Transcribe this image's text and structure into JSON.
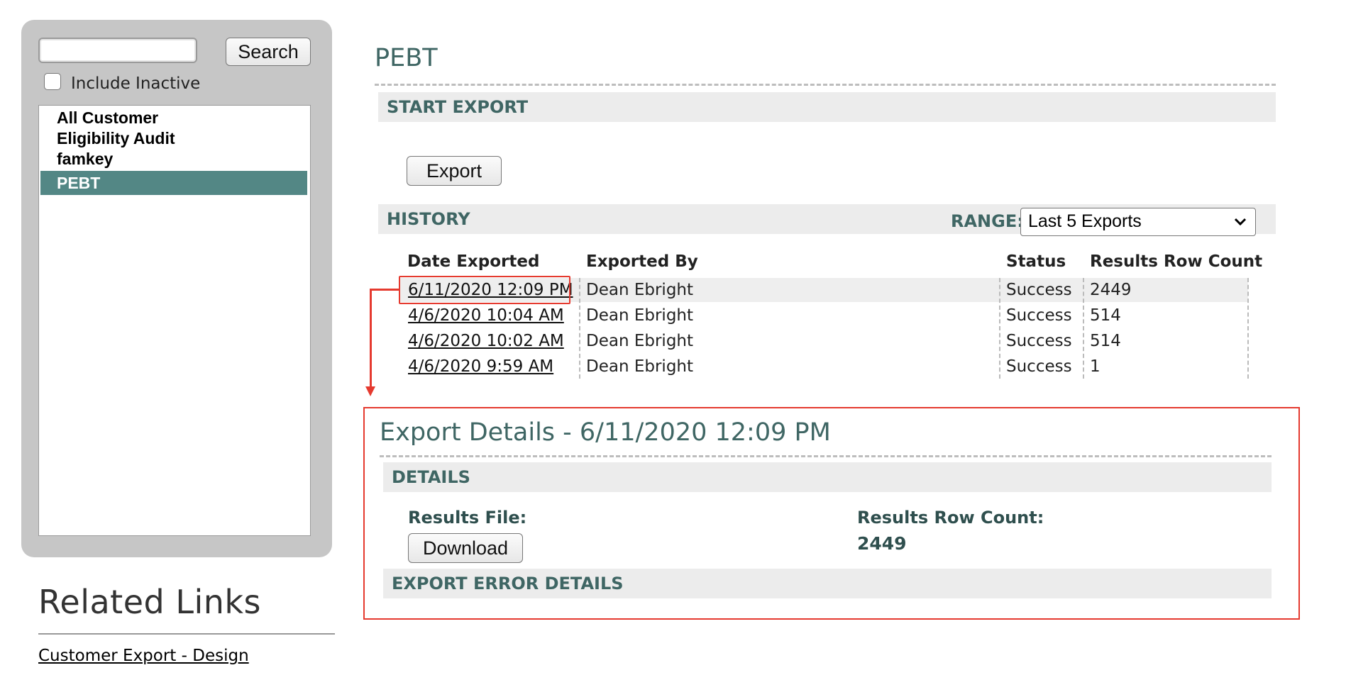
{
  "sidebar": {
    "search_value": "",
    "search_button": "Search",
    "include_inactive_label": "Include Inactive",
    "include_inactive_checked": false,
    "items": [
      {
        "label": "All Customer",
        "selected": false
      },
      {
        "label": "Eligibility Audit",
        "selected": false
      },
      {
        "label": "famkey",
        "selected": false
      },
      {
        "label": "PEBT",
        "selected": true
      }
    ]
  },
  "related": {
    "title": "Related Links",
    "links": [
      "Customer Export - Design"
    ]
  },
  "main": {
    "title": "PEBT",
    "start_export": {
      "heading": "START EXPORT",
      "button": "Export"
    },
    "history": {
      "heading": "HISTORY",
      "range_label": "RANGE:",
      "range_value": "Last 5 Exports",
      "columns": [
        "Date Exported",
        "Exported By",
        "Status",
        "Results Row Count"
      ],
      "rows": [
        {
          "date": "6/11/2020 12:09 PM",
          "by": "Dean Ebright",
          "status": "Success",
          "count": "2449"
        },
        {
          "date": "4/6/2020 10:04 AM",
          "by": "Dean Ebright",
          "status": "Success",
          "count": "514"
        },
        {
          "date": "4/6/2020 10:02 AM",
          "by": "Dean Ebright",
          "status": "Success",
          "count": "514"
        },
        {
          "date": "4/6/2020 9:59 AM",
          "by": "Dean Ebright",
          "status": "Success",
          "count": "1"
        }
      ]
    },
    "export_details": {
      "title": "Export Details - 6/11/2020 12:09 PM",
      "details_heading": "DETAILS",
      "results_file_label": "Results File:",
      "download_button": "Download",
      "row_count_label": "Results Row Count:",
      "row_count_value": "2449",
      "error_heading": "EXPORT ERROR DETAILS"
    }
  },
  "colors": {
    "accent": "#3f6664",
    "selected_bg": "#538785",
    "annotation_red": "#e53a2f"
  }
}
